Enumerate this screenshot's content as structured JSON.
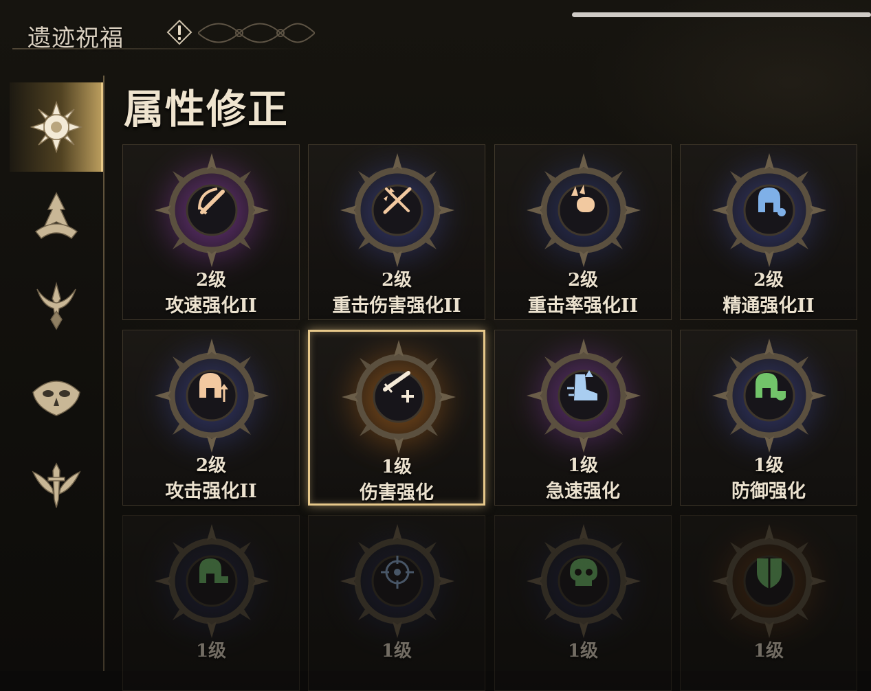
{
  "header": {
    "title": "遗迹祝福",
    "info_icon": "exclamation-diamond-icon"
  },
  "sidebar": {
    "items": [
      {
        "icon": "sun-emblem-icon",
        "active": true
      },
      {
        "icon": "spire-emblem-icon",
        "active": false
      },
      {
        "icon": "trident-emblem-icon",
        "active": false
      },
      {
        "icon": "mask-emblem-icon",
        "active": false
      },
      {
        "icon": "winged-sword-emblem-icon",
        "active": false
      }
    ]
  },
  "section": {
    "title": "属性修正"
  },
  "cards": [
    {
      "level": "2级",
      "name": "攻速强化II",
      "icon": "bow-sword-icon",
      "glow": "#8a3fa8",
      "icon_color": "#f2c9a0"
    },
    {
      "level": "2级",
      "name": "重击伤害强化II",
      "icon": "crossed-swords-burst-icon",
      "glow": "#3c4590",
      "icon_color": "#f2c9a0"
    },
    {
      "level": "2级",
      "name": "重击率强化II",
      "icon": "fist-burst-icon",
      "glow": "#2f3a78",
      "icon_color": "#f2c9a0"
    },
    {
      "level": "2级",
      "name": "精通强化II",
      "icon": "helmet-blue-icon",
      "glow": "#3c4590",
      "icon_color": "#7fb0e8"
    },
    {
      "level": "2级",
      "name": "攻击强化II",
      "icon": "helmet-up-icon",
      "glow": "#3c4590",
      "icon_color": "#f2c9a0"
    },
    {
      "level": "1级",
      "name": "伤害强化",
      "icon": "sword-plus-icon",
      "glow": "#b0661e",
      "icon_color": "#f5ead8",
      "selected": true
    },
    {
      "level": "1级",
      "name": "急速强化",
      "icon": "boot-speed-icon",
      "glow": "#7a3c9a",
      "icon_color": "#a9cdf0"
    },
    {
      "level": "1级",
      "name": "防御强化",
      "icon": "helmet-shield-icon",
      "glow": "#3c4590",
      "icon_color": "#72c46a"
    },
    {
      "level": "1级",
      "name": "",
      "icon": "helmet-green-icon",
      "glow": "#2b3470",
      "icon_color": "#6fbf6a",
      "dim": true
    },
    {
      "level": "1级",
      "name": "",
      "icon": "crosshair-icon",
      "glow": "#2b3470",
      "icon_color": "#8fb0d8",
      "dim": true
    },
    {
      "level": "1级",
      "name": "",
      "icon": "skull-icon",
      "glow": "#2b3470",
      "icon_color": "#6fbf6a",
      "dim": true
    },
    {
      "level": "1级",
      "name": "",
      "icon": "shield-green-icon",
      "glow": "#8a4a1a",
      "icon_color": "#6fbf6a",
      "dim": true
    }
  ],
  "colors": {
    "accent_gold": "#e7c88a",
    "text": "#ece2cf",
    "background": "#0b0a09"
  }
}
